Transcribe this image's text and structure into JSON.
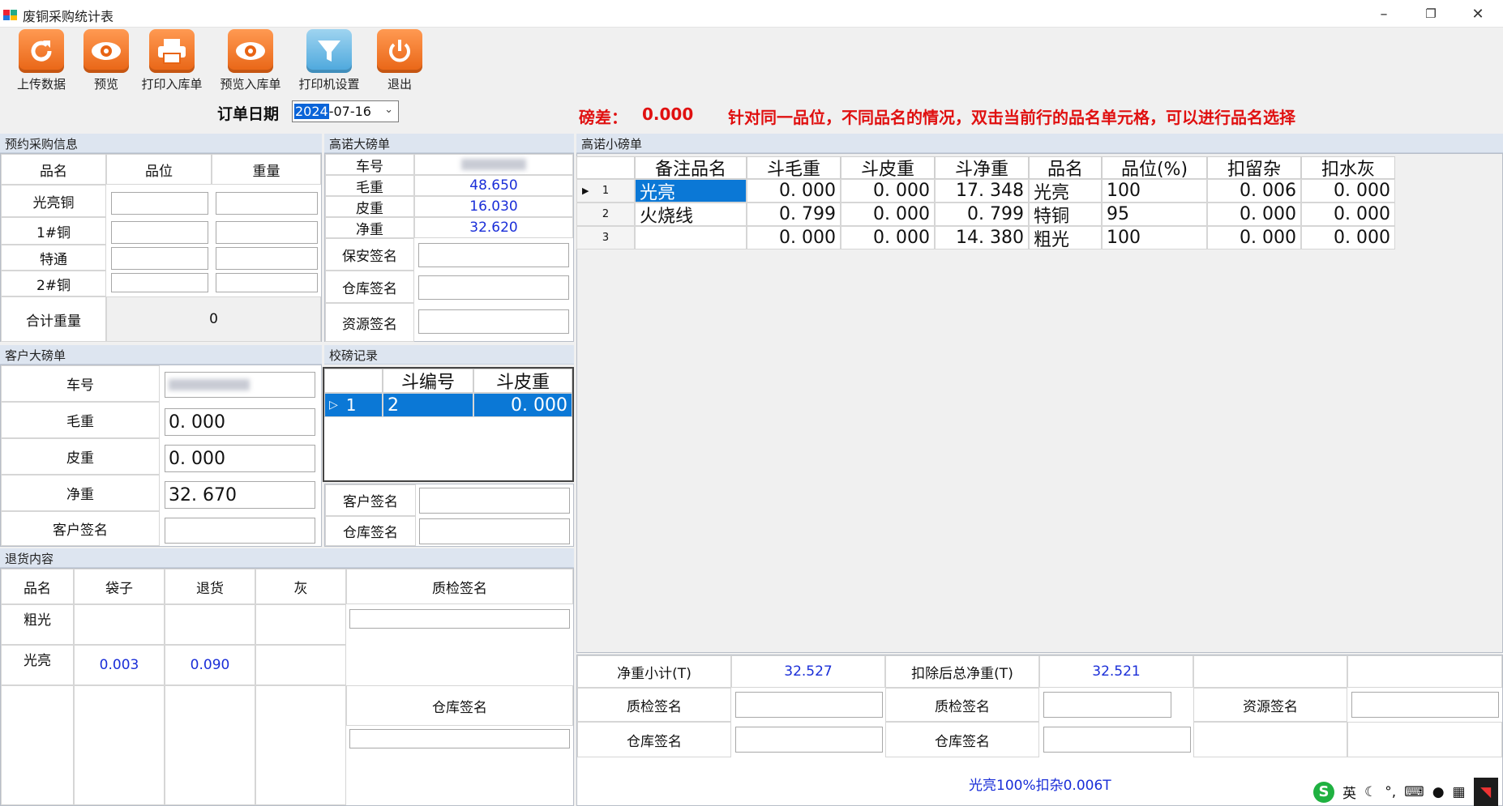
{
  "window": {
    "title": "废铜采购统计表",
    "min": "–",
    "restore": "❐",
    "close": "✕"
  },
  "toolbar": {
    "items": [
      {
        "label": "上传数据",
        "icon": "refresh-icon",
        "color": "orange"
      },
      {
        "label": "预览",
        "icon": "eye-icon",
        "color": "orange"
      },
      {
        "label": "打印入库单",
        "icon": "printer-icon",
        "color": "orange"
      },
      {
        "label": "预览入库单",
        "icon": "eye-icon",
        "color": "orange"
      },
      {
        "label": "打印机设置",
        "icon": "filter-icon",
        "color": "blue"
      },
      {
        "label": "退出",
        "icon": "power-icon",
        "color": "orange"
      }
    ]
  },
  "order_date": {
    "label": "订单日期",
    "year": "2024",
    "rest": "-07-16"
  },
  "diff": {
    "label": "磅差：",
    "value": "0.000"
  },
  "hint": "针对同一品位，不同品名的情况，双击当前行的品名单元格，可以进行品名选择",
  "reserve": {
    "title": "预约采购信息",
    "headers": [
      "品名",
      "品位",
      "重量"
    ],
    "rows": [
      "光亮铜",
      "1#铜",
      "特通",
      "2#铜"
    ],
    "total_label": "合计重量",
    "total_value": "0"
  },
  "gaonuo_big": {
    "title": "高诺大磅单",
    "plate_label": "车号",
    "gross_label": "毛重",
    "gross": "48.650",
    "tare_label": "皮重",
    "tare": "16.030",
    "net_label": "净重",
    "net": "32.620",
    "security_sign": "保安签名",
    "warehouse_sign": "仓库签名",
    "resource_sign": "资源签名"
  },
  "customer_big": {
    "title": "客户大磅单",
    "plate_label": "车号",
    "gross_label": "毛重",
    "gross": "0. 000",
    "tare_label": "皮重",
    "tare": "0. 000",
    "net_label": "净重",
    "net": "32. 670",
    "sign_label": "客户签名"
  },
  "calib": {
    "title": "校磅记录",
    "headers": [
      "斗编号",
      "斗皮重"
    ],
    "row": {
      "idx": "1",
      "no": "2",
      "tare": "0. 000"
    },
    "customer_sign": "客户签名",
    "warehouse_sign": "仓库签名"
  },
  "gaonuo_small": {
    "title": "高诺小磅单",
    "headers": [
      "备注品名",
      "斗毛重",
      "斗皮重",
      "斗净重",
      "品名",
      "品位(%)",
      "扣留杂",
      "扣水灰"
    ],
    "rows": [
      [
        "1",
        "光亮",
        "0. 000",
        "0. 000",
        "17. 348",
        "光亮",
        "100",
        "0. 006",
        "0. 000"
      ],
      [
        "2",
        "火烧线",
        "0. 799",
        "0. 000",
        "0. 799",
        "特铜",
        "95",
        "0. 000",
        "0. 000"
      ],
      [
        "3",
        "",
        "0. 000",
        "0. 000",
        "14. 380",
        "粗光",
        "100",
        "0. 000",
        "0. 000"
      ]
    ]
  },
  "return": {
    "title": "退货内容",
    "headers": [
      "品名",
      "袋子",
      "退货",
      "灰",
      "质检签名"
    ],
    "row1_name": "粗光",
    "row2_name": "光亮",
    "row2_bag": "0.003",
    "row2_ret": "0.090",
    "warehouse_sign": "仓库签名"
  },
  "summary": {
    "net_sub_label": "净重小计(T)",
    "net_sub": "32.527",
    "net_after_label": "扣除后总净重(T)",
    "net_after": "32.521",
    "qc1": "质检签名",
    "qc2": "质检签名",
    "res": "资源签名",
    "wh1": "仓库签名",
    "wh2": "仓库签名"
  },
  "footnote": "光亮100%扣杂0.006T",
  "tray": {
    "lang": "英"
  }
}
